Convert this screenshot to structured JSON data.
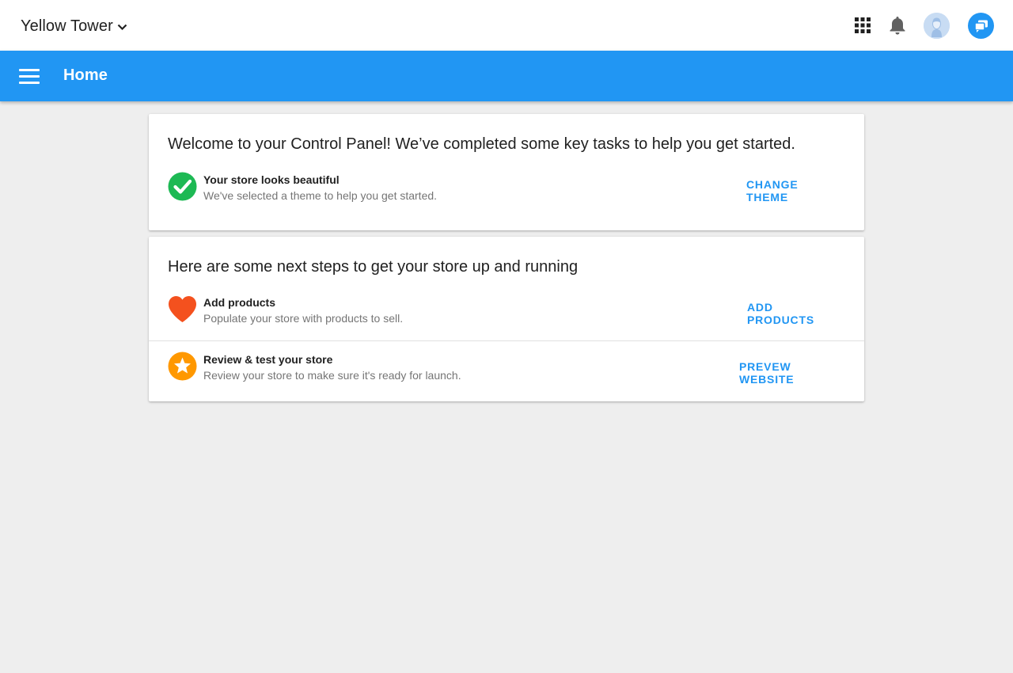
{
  "topbar": {
    "store_name": "Yellow Tower",
    "icons": [
      "chevron-down-icon",
      "apps-grid-icon",
      "bell-icon",
      "avatar-icon",
      "chat-icon"
    ]
  },
  "appbar": {
    "title": "Home",
    "menu_icon": "hamburger-menu-icon"
  },
  "welcome_card": {
    "heading": "Welcome to your Control Panel! We’ve completed some key tasks to help you get started.",
    "task": {
      "title": "Your store looks beautiful",
      "description": "We've selected a theme to help you get started.",
      "action": "CHANGE THEME",
      "icon": "check-circle-icon"
    }
  },
  "next_steps_card": {
    "heading": "Here are some next steps to get your store up and running",
    "tasks": [
      {
        "title": "Add products",
        "description": "Populate your store with products to sell.",
        "action": "ADD PRODUCTS",
        "icon": "heart-icon"
      },
      {
        "title": "Review & test your store",
        "description": "Review your store to make sure it's ready for launch.",
        "action": "PREVEW WEBSITE",
        "icon": "star-circle-icon"
      }
    ]
  },
  "colors": {
    "primary": "#2196f3",
    "background": "#eeeeee",
    "success": "#1db954",
    "heart": "#f4511e",
    "star": "#ff9800"
  }
}
